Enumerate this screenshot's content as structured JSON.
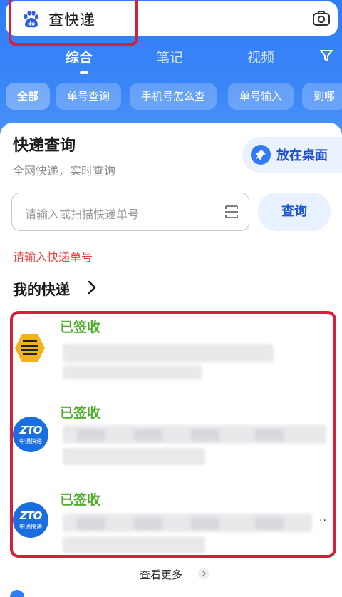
{
  "search": {
    "query": "查快递"
  },
  "tabs": [
    {
      "label": "综合",
      "active": true
    },
    {
      "label": "笔记",
      "active": false
    },
    {
      "label": "视频",
      "active": false
    }
  ],
  "chips": [
    "全部",
    "单号查询",
    "手机号怎么查",
    "单号输入",
    "到哪"
  ],
  "card": {
    "title": "快递查询",
    "subtitle": "全网快递，实时查询",
    "pin_label": "放在桌面"
  },
  "tracking": {
    "placeholder": "请输入或扫描快递单号",
    "query_label": "查询",
    "error": "请输入快递单号"
  },
  "my_packages": {
    "title": "我的快递",
    "items": [
      {
        "status": "已签收",
        "carrier_icon": "hex-courier-logo"
      },
      {
        "status": "已签收",
        "carrier_icon": "zto-logo",
        "logo_text": "ZTO",
        "logo_sub": "中通快递"
      },
      {
        "status": "已签收",
        "carrier_icon": "zto-logo",
        "logo_text": "ZTO",
        "logo_sub": "中通快递"
      }
    ],
    "more": "查看更多"
  },
  "colors": {
    "brand_blue": "#2f7cf6",
    "status_green": "#4fad2c",
    "error_red": "#e8413e",
    "highlight_red": "#d81e3b"
  }
}
